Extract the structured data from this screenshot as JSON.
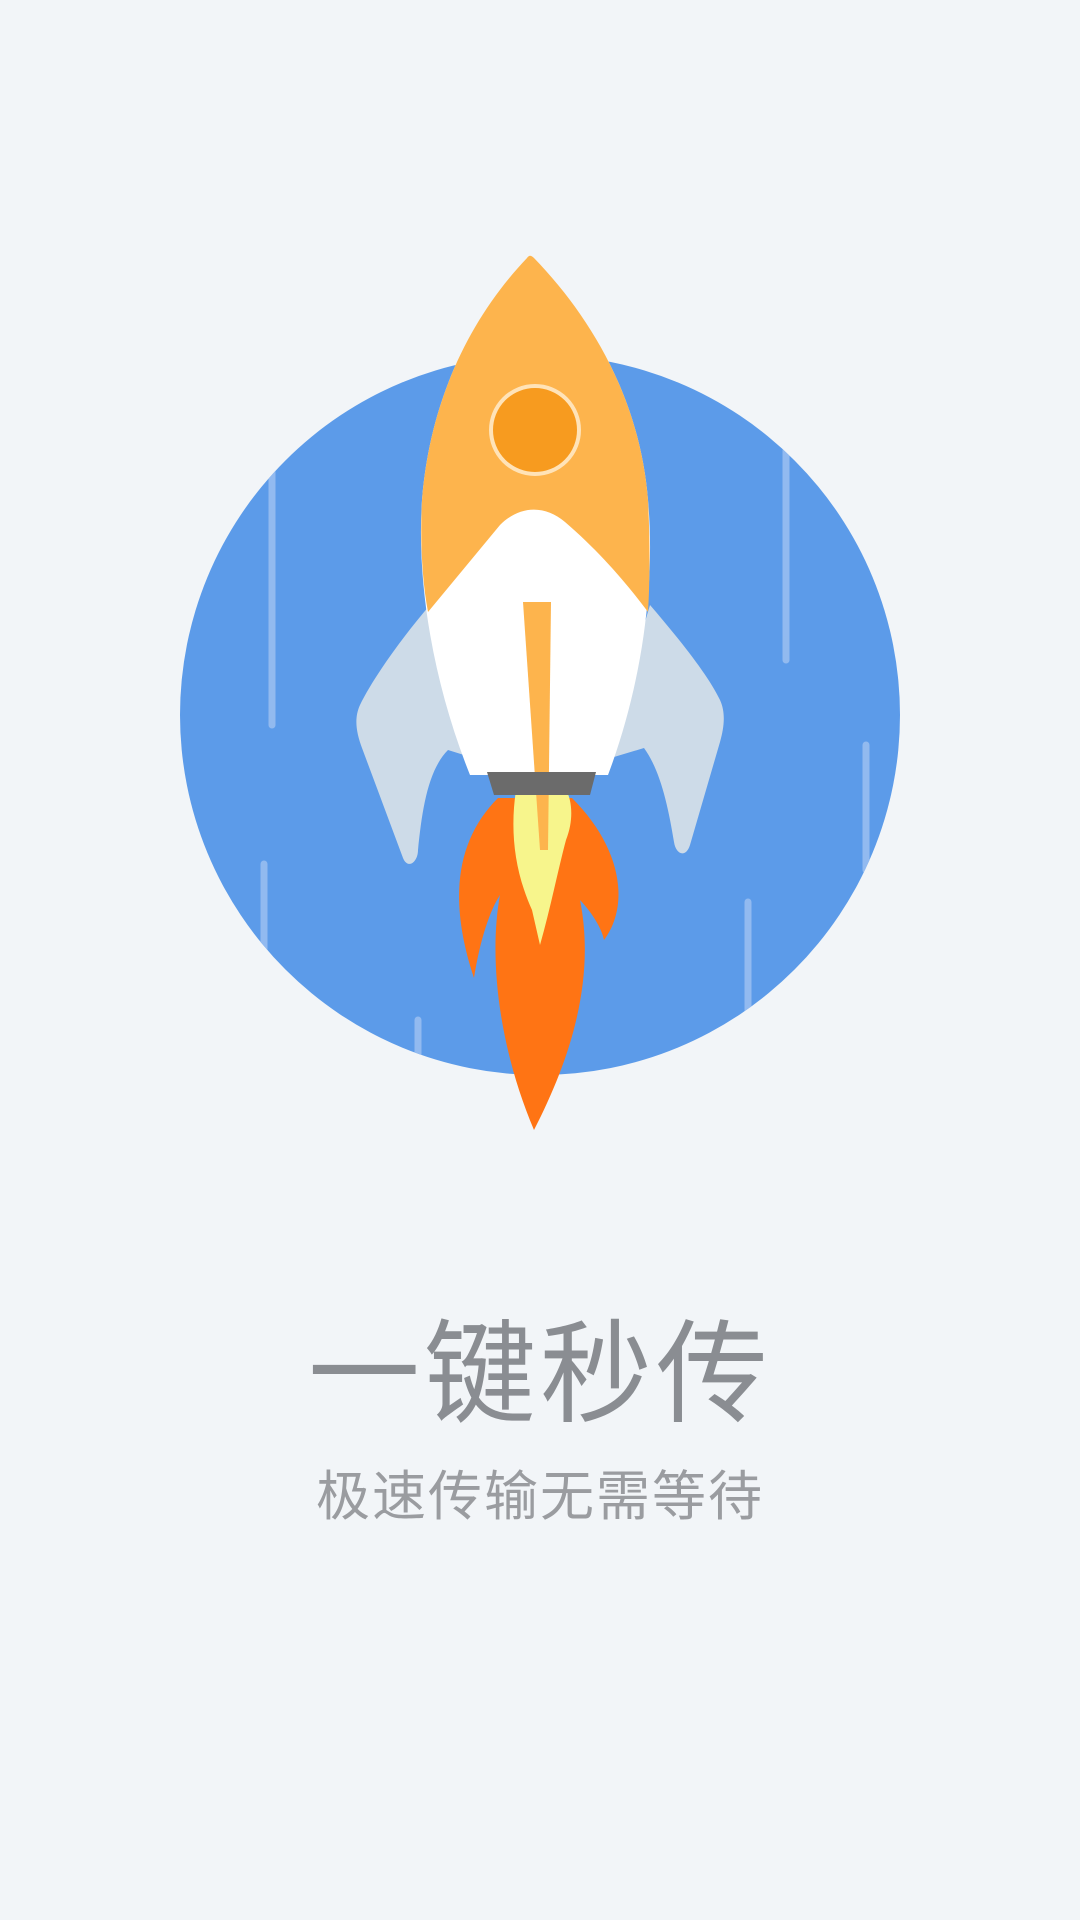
{
  "splash": {
    "headline": "一键秒传",
    "subline": "极速传输无需等待"
  },
  "illustration": {
    "icon": "rocket-icon",
    "colors": {
      "background": "#f2f5f8",
      "circle": "#5c9be9",
      "rocket_body_top": "#fdb44d",
      "rocket_window": "#f79b1f",
      "rocket_body_bottom": "#ffffff",
      "fins": "#cddbe8",
      "flame_outer": "#ff7414",
      "flame_inner": "#f7f58c",
      "nozzle": "#6b6b6b"
    }
  }
}
